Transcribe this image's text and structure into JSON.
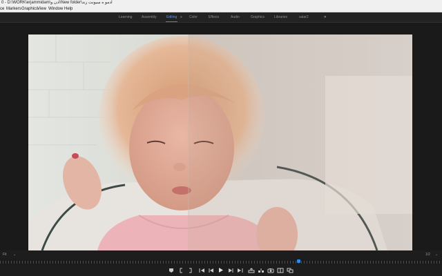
{
  "title_bar": {
    "text": "0 - D:\\WORK\\erjammidam\\ادن و\\New folder\\آدمو ه سیونت زند"
  },
  "menu": {
    "items": [
      "ce",
      "Markers",
      "Graphics",
      "View",
      "Window",
      "Help"
    ]
  },
  "workspaces": {
    "tabs": [
      "Learning",
      "Assembly",
      "Editing",
      "Color",
      "Effects",
      "Audio",
      "Graphics",
      "Libraries",
      "salar2"
    ],
    "active": "Editing",
    "menu_glyph": "≡",
    "more_glyph": "»"
  },
  "program_monitor": {
    "zoom_label": "Fit",
    "zoom_glyph": "⌄",
    "resolution_label": "1/2",
    "resolution_glyph": "⌄",
    "content": "video-frame-child-split-comparison"
  },
  "transport": {
    "icons": [
      "marker-icon",
      "in-point-icon",
      "out-point-icon",
      "go-to-in-icon",
      "step-back-icon",
      "play-icon",
      "step-forward-icon",
      "go-to-out-icon",
      "lift-icon",
      "extract-icon",
      "export-frame-icon",
      "compare-icon",
      "multicam-icon"
    ]
  },
  "colors": {
    "accent": "#2d8ceb",
    "background": "#1d1d1d",
    "panel": "#232323",
    "menu_bg": "#f0f0f0"
  }
}
